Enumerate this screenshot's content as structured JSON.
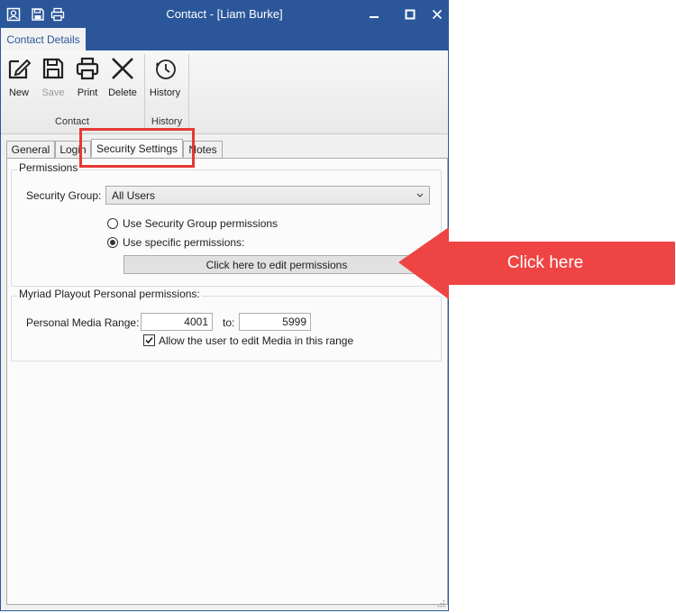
{
  "window": {
    "title": "Contact - [Liam Burke]",
    "accent": "#2b579a"
  },
  "ribbon": {
    "tab_label": "Contact Details",
    "groups": {
      "contact": "Contact",
      "history": "History"
    },
    "buttons": {
      "new": "New",
      "save": "Save",
      "print": "Print",
      "delete": "Delete",
      "history": "History"
    }
  },
  "tabs": {
    "general": "General",
    "login": "Login",
    "security": "Security Settings",
    "notes": "Notes",
    "active": "security"
  },
  "permissions": {
    "group_title": "Permissions",
    "security_group_label": "Security Group:",
    "security_group_value": "All Users",
    "radio_group": "Use Security Group permissions",
    "radio_specific": "Use specific permissions:",
    "selected": "specific",
    "edit_button": "Click here to edit permissions"
  },
  "myriad": {
    "group_title": "Myriad Playout Personal permissions:",
    "range_label": "Personal Media Range:",
    "range_from": "4001",
    "to_label": "to:",
    "range_to": "5999",
    "allow_edit_label": "Allow the user to edit Media in this range",
    "allow_edit_checked": true
  },
  "annotation": {
    "callout_text": "Click here",
    "color": "#ef4444"
  },
  "icons": [
    "contact-card-icon",
    "save-icon",
    "print-icon",
    "minimize-icon",
    "maximize-icon",
    "close-icon",
    "new-icon",
    "delete-icon",
    "history-clock-icon",
    "dropdown-chevron-icon",
    "checkmark-icon",
    "resize-grip-icon"
  ]
}
